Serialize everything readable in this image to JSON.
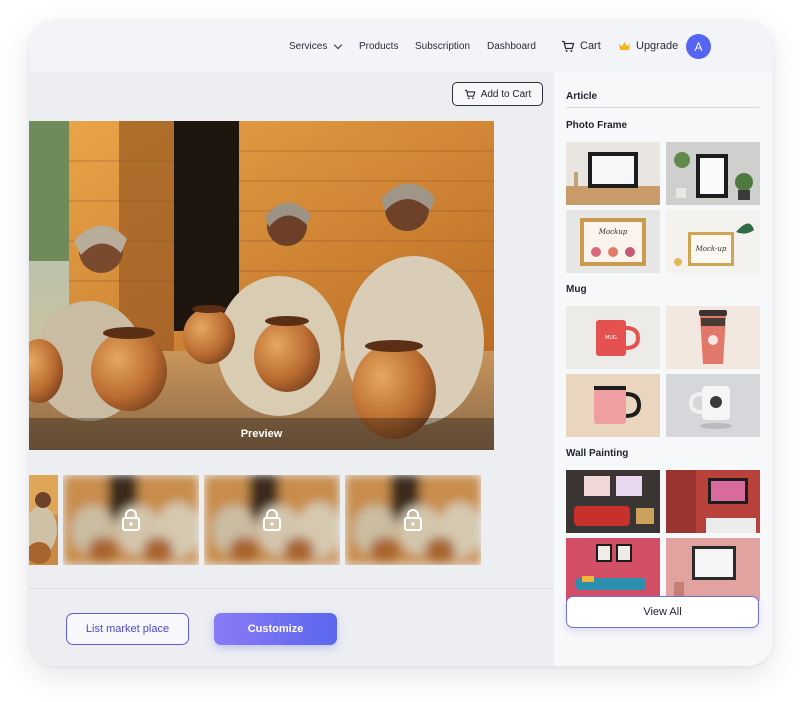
{
  "nav": {
    "items": [
      {
        "label": "Services",
        "has_dropdown": true
      },
      {
        "label": "Products"
      },
      {
        "label": "Subscription"
      },
      {
        "label": "Dashboard"
      }
    ],
    "cart_label": "Cart",
    "upgrade_label": "Upgrade",
    "avatar_initial": "A",
    "colors": {
      "avatar": "#5564f2",
      "crown": "#f2b51a"
    }
  },
  "main": {
    "add_to_cart_label": "Add to Cart",
    "preview_label": "Preview",
    "preview_image": "women-with-clay-pots",
    "thumbnails": [
      {
        "kind": "women-with-clay-pots",
        "locked": false
      },
      {
        "kind": "women-with-clay-pots-blurred",
        "locked": true
      },
      {
        "kind": "women-with-clay-pots-blurred",
        "locked": true
      },
      {
        "kind": "women-with-clay-pots-blurred",
        "locked": true
      }
    ],
    "list_market_label": "List market place",
    "customize_label": "Customize"
  },
  "side": {
    "title": "Article",
    "categories": [
      {
        "name": "Photo Frame",
        "items": [
          "frame-on-shelf",
          "frame-with-plants",
          "floral-frame-mockup",
          "frame-with-leaf-mockup"
        ]
      },
      {
        "name": "Mug",
        "items": [
          "red-mug",
          "coffee-cup",
          "pink-mug",
          "white-mug"
        ]
      },
      {
        "name": "Wall Painting",
        "items": [
          "red-sofa-room",
          "red-wall-room",
          "pink-room-sofa",
          "pink-wall-frame"
        ]
      }
    ],
    "view_all_label": "View All"
  }
}
